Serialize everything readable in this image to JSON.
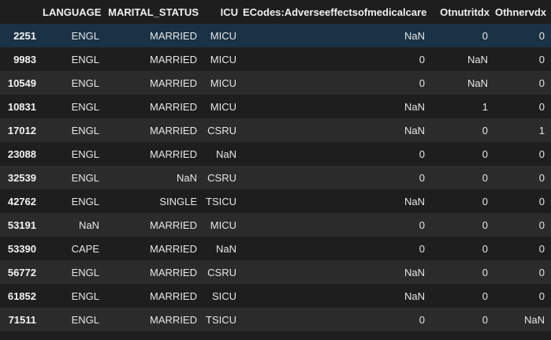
{
  "table": {
    "columns": [
      "",
      "LANGUAGE",
      "MARITAL_STATUS",
      "ICU",
      "ECodes:Adverseeffectsofmedicalcare",
      "Otnutritdx",
      "Othnervdx"
    ],
    "rows": [
      {
        "index": "2251",
        "language": "ENGL",
        "marital_status": "MARRIED",
        "icu": "MICU",
        "ecodes": "NaN",
        "otnutritdx": "0",
        "othnervdx": "0"
      },
      {
        "index": "9983",
        "language": "ENGL",
        "marital_status": "MARRIED",
        "icu": "MICU",
        "ecodes": "0",
        "otnutritdx": "NaN",
        "othnervdx": "0"
      },
      {
        "index": "10549",
        "language": "ENGL",
        "marital_status": "MARRIED",
        "icu": "MICU",
        "ecodes": "0",
        "otnutritdx": "NaN",
        "othnervdx": "0"
      },
      {
        "index": "10831",
        "language": "ENGL",
        "marital_status": "MARRIED",
        "icu": "MICU",
        "ecodes": "NaN",
        "otnutritdx": "1",
        "othnervdx": "0"
      },
      {
        "index": "17012",
        "language": "ENGL",
        "marital_status": "MARRIED",
        "icu": "CSRU",
        "ecodes": "NaN",
        "otnutritdx": "0",
        "othnervdx": "1"
      },
      {
        "index": "23088",
        "language": "ENGL",
        "marital_status": "MARRIED",
        "icu": "NaN",
        "ecodes": "0",
        "otnutritdx": "0",
        "othnervdx": "0"
      },
      {
        "index": "32539",
        "language": "ENGL",
        "marital_status": "NaN",
        "icu": "CSRU",
        "ecodes": "0",
        "otnutritdx": "0",
        "othnervdx": "0"
      },
      {
        "index": "42762",
        "language": "ENGL",
        "marital_status": "SINGLE",
        "icu": "TSICU",
        "ecodes": "NaN",
        "otnutritdx": "0",
        "othnervdx": "0"
      },
      {
        "index": "53191",
        "language": "NaN",
        "marital_status": "MARRIED",
        "icu": "MICU",
        "ecodes": "0",
        "otnutritdx": "0",
        "othnervdx": "0"
      },
      {
        "index": "53390",
        "language": "CAPE",
        "marital_status": "MARRIED",
        "icu": "NaN",
        "ecodes": "0",
        "otnutritdx": "0",
        "othnervdx": "0"
      },
      {
        "index": "56772",
        "language": "ENGL",
        "marital_status": "MARRIED",
        "icu": "CSRU",
        "ecodes": "NaN",
        "otnutritdx": "0",
        "othnervdx": "0"
      },
      {
        "index": "61852",
        "language": "ENGL",
        "marital_status": "MARRIED",
        "icu": "SICU",
        "ecodes": "NaN",
        "otnutritdx": "0",
        "othnervdx": "0"
      },
      {
        "index": "71511",
        "language": "ENGL",
        "marital_status": "MARRIED",
        "icu": "TSICU",
        "ecodes": "0",
        "otnutritdx": "0",
        "othnervdx": "NaN"
      }
    ]
  },
  "colors": {
    "background": "#1e1e1e",
    "row_striped": "#2b2b2b",
    "row_selected": "#193246",
    "text": "#e6e6e6"
  }
}
